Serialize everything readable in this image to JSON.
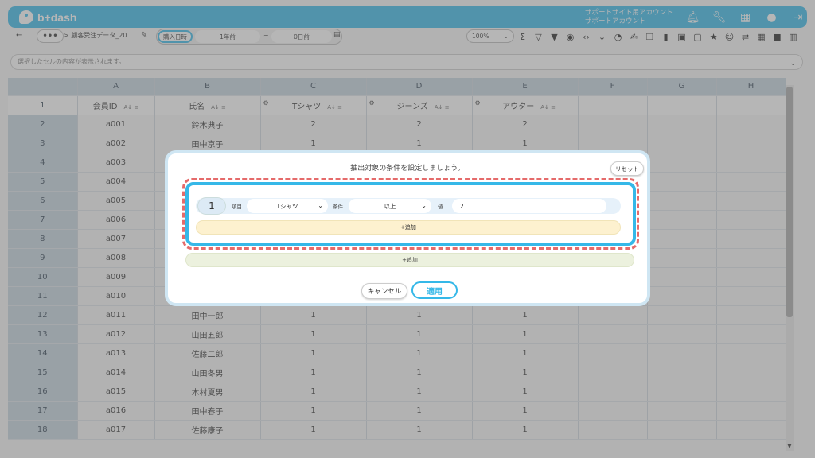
{
  "header": {
    "logo_text": "b+dash",
    "account_line1": "サポートサイト用アカウント",
    "account_line2": "サポートアカウント",
    "icons": [
      "bell-icon",
      "wrench-icon",
      "apps-grid-icon",
      "chat-icon",
      "logout-icon"
    ]
  },
  "toolbar": {
    "back": "←",
    "more": "•••",
    "breadcrumb": "> 顧客受注データ_20…",
    "date_field": "購入日時",
    "date_from": "1年前",
    "tilde": "~",
    "date_to": "0日前",
    "zoom": "100%"
  },
  "cellbar": {
    "placeholder": "選択したセルの内容が表示されます。"
  },
  "grid": {
    "columns": [
      "A",
      "B",
      "C",
      "D",
      "E",
      "F",
      "G",
      "H"
    ],
    "field_headers": [
      "会員ID",
      "氏名",
      "Tシャツ",
      "ジーンズ",
      "アウター"
    ],
    "rows": [
      {
        "n": "2",
        "id": "a001",
        "name": "鈴木典子",
        "c": "2",
        "d": "2",
        "e": "2"
      },
      {
        "n": "3",
        "id": "a002",
        "name": "田中京子",
        "c": "1",
        "d": "1",
        "e": "1"
      },
      {
        "n": "4",
        "id": "a003",
        "name": "",
        "c": "",
        "d": "",
        "e": ""
      },
      {
        "n": "5",
        "id": "a004",
        "name": "",
        "c": "",
        "d": "",
        "e": ""
      },
      {
        "n": "6",
        "id": "a005",
        "name": "",
        "c": "",
        "d": "",
        "e": ""
      },
      {
        "n": "7",
        "id": "a006",
        "name": "",
        "c": "",
        "d": "",
        "e": ""
      },
      {
        "n": "8",
        "id": "a007",
        "name": "",
        "c": "",
        "d": "",
        "e": ""
      },
      {
        "n": "9",
        "id": "a008",
        "name": "",
        "c": "",
        "d": "",
        "e": ""
      },
      {
        "n": "10",
        "id": "a009",
        "name": "",
        "c": "",
        "d": "",
        "e": ""
      },
      {
        "n": "11",
        "id": "a010",
        "name": "",
        "c": "",
        "d": "",
        "e": ""
      },
      {
        "n": "12",
        "id": "a011",
        "name": "田中一郎",
        "c": "1",
        "d": "1",
        "e": "1"
      },
      {
        "n": "13",
        "id": "a012",
        "name": "山田五郎",
        "c": "1",
        "d": "1",
        "e": "1"
      },
      {
        "n": "14",
        "id": "a013",
        "name": "佐藤二郎",
        "c": "1",
        "d": "1",
        "e": "1"
      },
      {
        "n": "15",
        "id": "a014",
        "name": "山田冬男",
        "c": "1",
        "d": "1",
        "e": "1"
      },
      {
        "n": "16",
        "id": "a015",
        "name": "木村夏男",
        "c": "1",
        "d": "1",
        "e": "1"
      },
      {
        "n": "17",
        "id": "a016",
        "name": "田中春子",
        "c": "1",
        "d": "1",
        "e": "1"
      },
      {
        "n": "18",
        "id": "a017",
        "name": "佐藤康子",
        "c": "1",
        "d": "1",
        "e": "1"
      }
    ]
  },
  "modal": {
    "title": "抽出対象の条件を設定しましょう。",
    "reset": "リセット",
    "condition": {
      "number": "1",
      "field_label": "項目",
      "field_value": "Tシャツ",
      "cond_label": "条件",
      "cond_value": "以上",
      "value_label": "値",
      "value": "2"
    },
    "add_inner": "+追加",
    "add_outer": "+追加",
    "cancel": "キャンセル",
    "apply": "適用"
  },
  "colors": {
    "accent": "#35b8e8",
    "highlight_dash": "#e56b6b"
  }
}
